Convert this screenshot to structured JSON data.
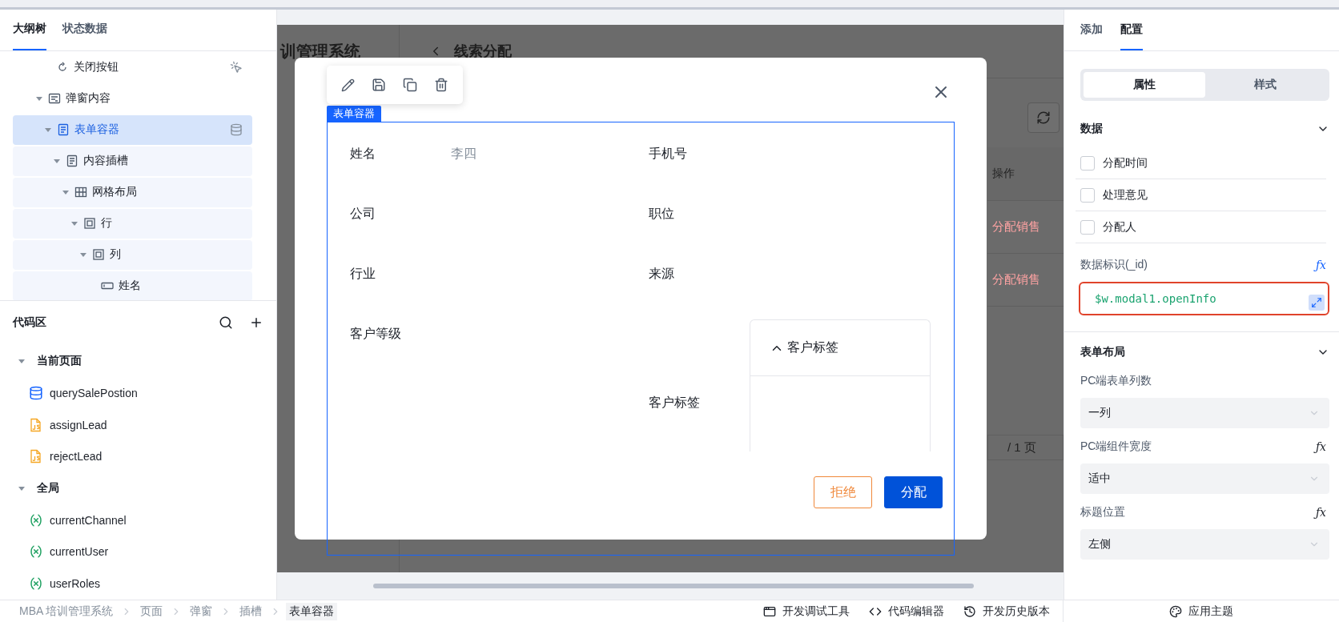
{
  "outline_panel": {
    "tabs": [
      {
        "label": "大纲树",
        "selected": true
      },
      {
        "label": "状态数据",
        "selected": false
      }
    ],
    "tree": [
      {
        "label": "关闭按钮",
        "kind": "button",
        "has_event": true,
        "selected": false
      },
      {
        "label": "弹窗内容",
        "kind": "container",
        "selected": false,
        "expanded": true,
        "children": [
          {
            "label": "表单容器",
            "kind": "form",
            "data_bound": true,
            "selected": true,
            "expanded": true,
            "children": [
              {
                "label": "内容插槽",
                "kind": "form",
                "selected": false,
                "expanded": true,
                "children": [
                  {
                    "label": "网格布局",
                    "kind": "grid",
                    "selected": false,
                    "expanded": true,
                    "children": [
                      {
                        "label": "行",
                        "kind": "box",
                        "selected": false,
                        "expanded": true,
                        "children": [
                          {
                            "label": "列",
                            "kind": "box",
                            "selected": false,
                            "expanded": true,
                            "children": [
                              {
                                "label": "姓名",
                                "kind": "input",
                                "selected": false
                              }
                            ]
                          }
                        ]
                      }
                    ]
                  }
                ]
              }
            ]
          }
        ]
      }
    ]
  },
  "code_panel": {
    "title": "代码区",
    "groups": [
      {
        "label": "当前页面",
        "expanded": true,
        "items": [
          {
            "name": "querySalePostion",
            "kind": "query"
          },
          {
            "name": "assignLead",
            "kind": "js"
          },
          {
            "name": "rejectLead",
            "kind": "js"
          }
        ]
      },
      {
        "label": "全局",
        "expanded": true,
        "items": [
          {
            "name": "currentChannel",
            "kind": "variable"
          },
          {
            "name": "currentUser",
            "kind": "variable"
          },
          {
            "name": "userRoles",
            "kind": "variable"
          }
        ]
      }
    ]
  },
  "canvas": {
    "page": {
      "app_title": "训管理系统",
      "page_title": "线索分配",
      "action_header": "操作",
      "row_actions": [
        "分配销售",
        "分配销售"
      ],
      "pager": "/ 1 页"
    },
    "modal": {
      "selection_tag": "表单容器",
      "fields": [
        {
          "label": "姓名",
          "placeholder": "李四"
        },
        {
          "label": "手机号"
        },
        {
          "label": "公司"
        },
        {
          "label": "职位"
        },
        {
          "label": "行业"
        },
        {
          "label": "来源"
        },
        {
          "label": "客户等级"
        },
        {
          "label": "客户标签",
          "kind": "tags",
          "card_title": "客户标签"
        }
      ],
      "buttons": [
        {
          "label": "拒绝",
          "kind": "outline"
        },
        {
          "label": "分配",
          "kind": "primary"
        }
      ]
    }
  },
  "config_panel": {
    "tabs": [
      {
        "label": "添加",
        "selected": false
      },
      {
        "label": "配置",
        "selected": true
      }
    ],
    "segments": [
      {
        "label": "属性",
        "selected": true
      },
      {
        "label": "样式",
        "selected": false
      }
    ],
    "data_section": {
      "title": "数据",
      "expanded": true,
      "fields": [
        {
          "label": "分配时间",
          "checked": false
        },
        {
          "label": "处理意见",
          "checked": false
        },
        {
          "label": "分配人",
          "checked": false
        }
      ],
      "id_label": "数据标识(_id)",
      "formula": "ƒx",
      "id_value": "$w.modal1.openInfo"
    },
    "layout_section": {
      "title": "表单布局",
      "expanded": true,
      "settings": [
        {
          "label": "PC端表单列数",
          "value": "一列"
        },
        {
          "label": "PC端组件宽度",
          "value": "适中",
          "formula": "ƒx"
        },
        {
          "label": "标题位置",
          "value": "左侧",
          "formula": "ƒx"
        }
      ]
    }
  },
  "status_bar": {
    "breadcrumb": [
      "MBA 培训管理系统",
      "页面",
      "弹窗",
      "插槽",
      "表单容器"
    ],
    "tools": [
      {
        "label": "开发调试工具",
        "kind": "debug"
      },
      {
        "label": "代码编辑器",
        "kind": "code"
      },
      {
        "label": "开发历史版本",
        "kind": "history"
      }
    ],
    "theme": "应用主题"
  }
}
